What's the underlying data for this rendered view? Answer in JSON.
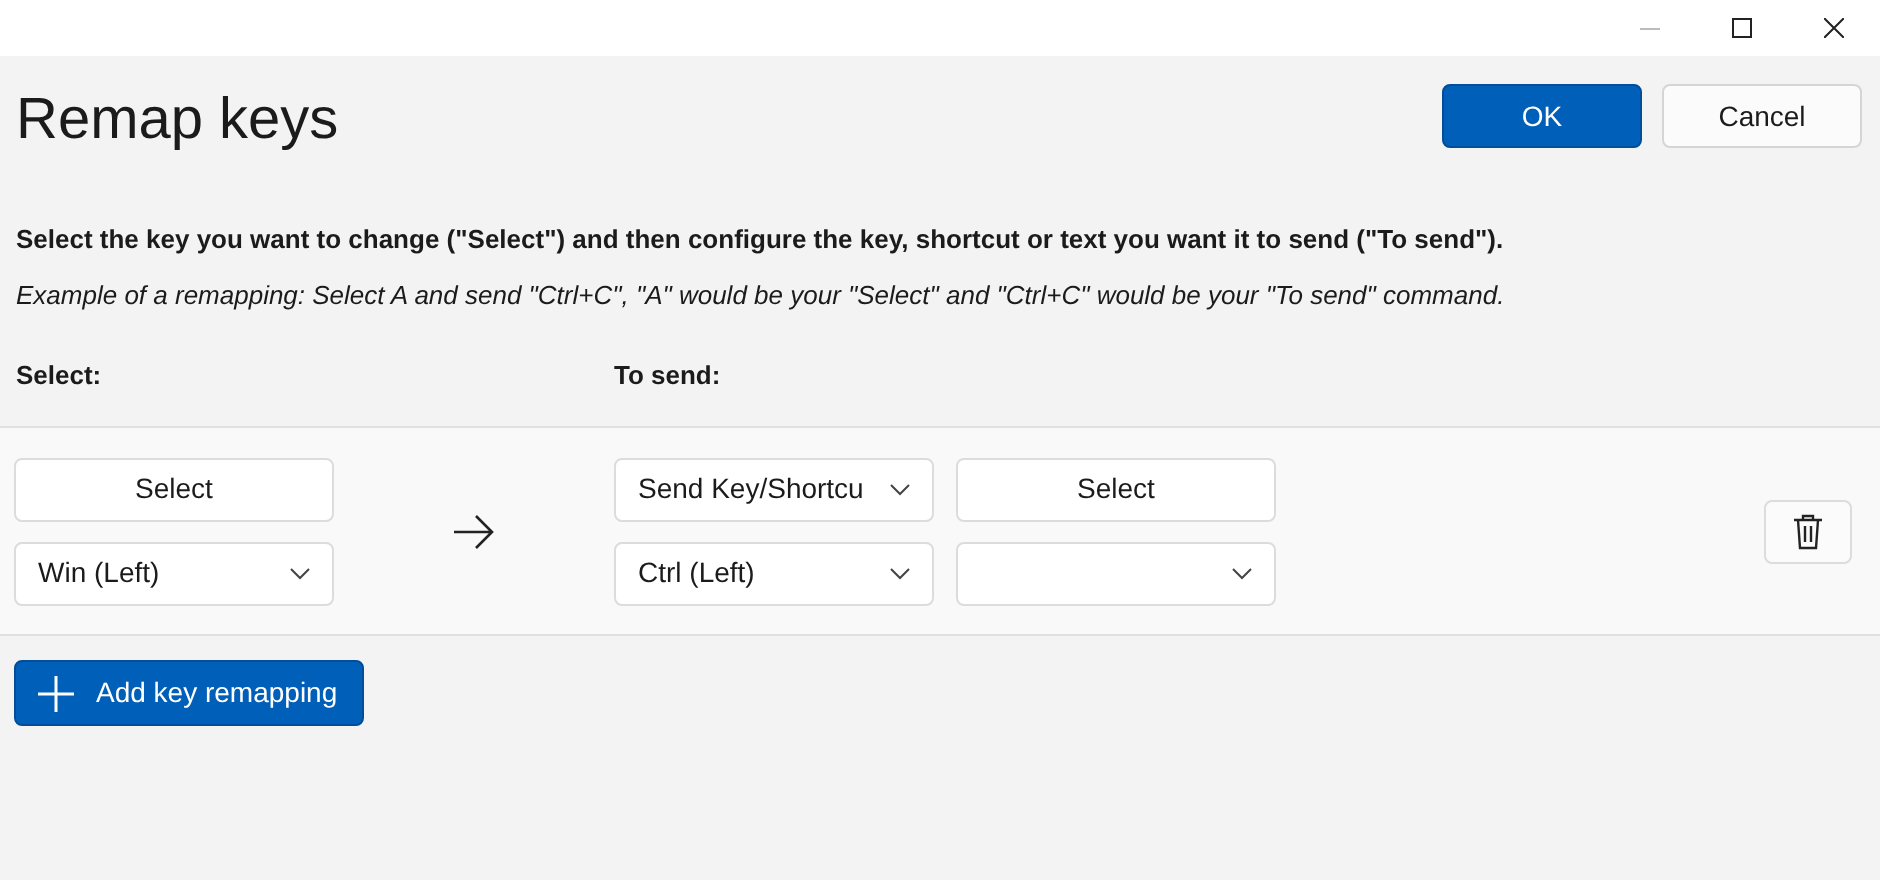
{
  "title": "Remap keys",
  "buttons": [
    {
      "label": "OK",
      "kind": "primary"
    },
    {
      "label": "Cancel",
      "kind": "secondary"
    }
  ],
  "instructions": "Select the key you want to change (\"Select\") and then configure the key, shortcut or text you want it to send (\"To send\").",
  "example": "Example of a remapping: Select A and send \"Ctrl+C\", \"A\" would be your \"Select\" and \"Ctrl+C\" would be your \"To send\" command.",
  "columns": [
    "Select:",
    "To send:"
  ],
  "remappings": [
    {
      "select_button": "Select",
      "original_key": "Win (Left)",
      "send_type": "Send Key/Shortcu",
      "send_select_button": "Select",
      "send_key": "Ctrl (Left)"
    }
  ],
  "add_button": "Add key remapping"
}
